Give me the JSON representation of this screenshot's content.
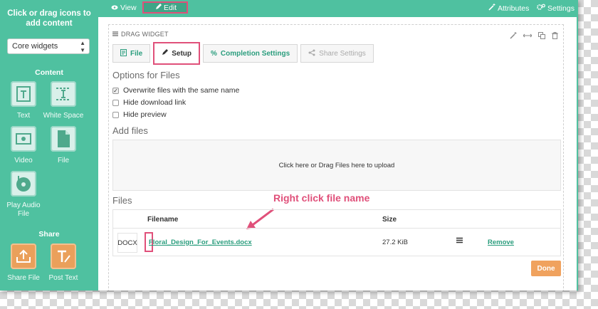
{
  "sidebar": {
    "hint": "Click or drag icons to add content",
    "select_value": "Core widgets",
    "content_title": "Content",
    "content_items": [
      {
        "label": "Text"
      },
      {
        "label": "White Space"
      },
      {
        "label": "Video"
      },
      {
        "label": "File"
      },
      {
        "label": "Play Audio File"
      }
    ],
    "share_title": "Share",
    "share_items": [
      {
        "label": "Share File"
      },
      {
        "label": "Post Text"
      }
    ]
  },
  "topbar": {
    "view": "View",
    "edit": "Edit",
    "attributes": "Attributes",
    "settings": "Settings"
  },
  "widget": {
    "drag_title": "DRAG WIDGET",
    "tabs": [
      {
        "label": "File"
      },
      {
        "label": "Setup"
      },
      {
        "label": "Completion Settings"
      },
      {
        "label": "Share Settings"
      }
    ],
    "options_heading": "Options for Files",
    "options": [
      {
        "label": "Overwrite files with the same name",
        "checked": true
      },
      {
        "label": "Hide download link",
        "checked": false
      },
      {
        "label": "Hide preview",
        "checked": false
      }
    ],
    "add_files_heading": "Add files",
    "dropzone_text": "Click here or Drag Files here to upload",
    "files_heading": "Files",
    "annotation": "Right click file name",
    "columns": {
      "filename": "Filename",
      "size": "Size"
    },
    "file": {
      "type": "DOCX",
      "name": "Floral_Design_For_Events.docx",
      "size": "27.2 KiB",
      "remove": "Remove"
    },
    "done": "Done"
  },
  "colors": {
    "sidebar": "#4fc1a0",
    "accent": "#2a9d7d",
    "highlight": "#e0507a",
    "done": "#f0a25e"
  }
}
